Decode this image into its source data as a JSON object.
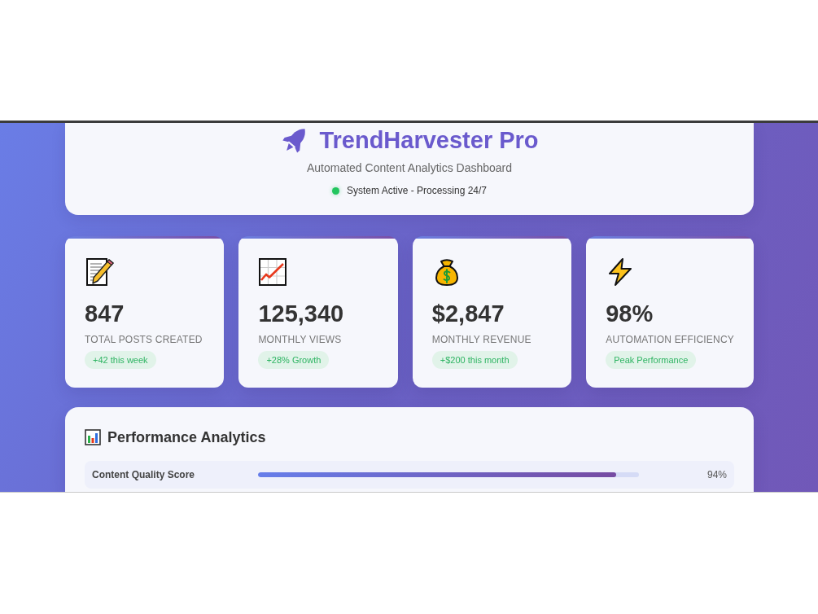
{
  "header": {
    "title": "TrendHarvester Pro",
    "subtitle": "Automated Content Analytics Dashboard",
    "status": "System Active - Processing 24/7"
  },
  "stats": [
    {
      "value": "847",
      "label": "TOTAL POSTS CREATED",
      "badge": "+42 this week"
    },
    {
      "value": "125,340",
      "label": "MONTHLY VIEWS",
      "badge": "+28% Growth"
    },
    {
      "value": "$2,847",
      "label": "MONTHLY REVENUE",
      "badge": "+$200 this month"
    },
    {
      "value": "98%",
      "label": "AUTOMATION EFFICIENCY",
      "badge": "Peak Performance"
    }
  ],
  "analytics": {
    "title": "Performance Analytics",
    "metrics": [
      {
        "label": "Content Quality Score",
        "level": 0.94,
        "reading": "94%"
      }
    ]
  }
}
